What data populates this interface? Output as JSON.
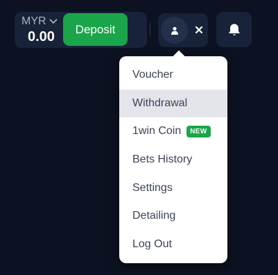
{
  "balance": {
    "currency": "MYR",
    "amount": "0.00",
    "deposit_label": "Deposit"
  },
  "icons": {
    "currency_chevron": "chevron-down-icon",
    "avatar": "user-icon",
    "close": "close-icon",
    "notifications": "bell-icon"
  },
  "account_menu": {
    "items": [
      {
        "label": "Voucher"
      },
      {
        "label": "Withdrawal",
        "active": true
      },
      {
        "label": "1win Coin",
        "badge": "NEW"
      },
      {
        "label": "Bets History"
      },
      {
        "label": "Settings"
      },
      {
        "label": "Detailing"
      },
      {
        "label": "Log Out"
      }
    ]
  },
  "colors": {
    "background": "#0c1221",
    "panel": "#182238",
    "accent_green": "#1ba54a",
    "menu_hover": "#e3e5ea"
  }
}
